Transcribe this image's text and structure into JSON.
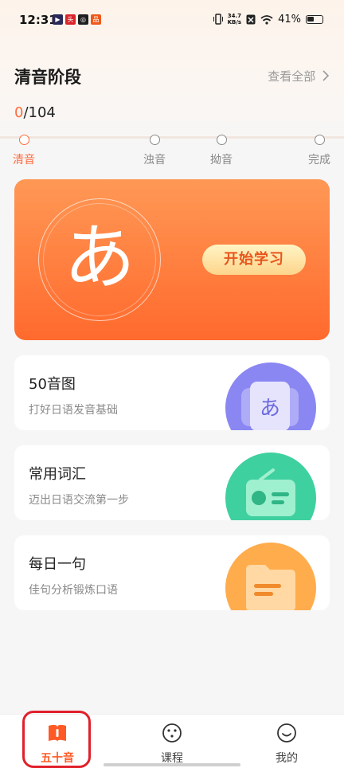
{
  "status_bar": {
    "time": "12:31",
    "net_speed_value": "34.7",
    "net_speed_unit": "KB/s",
    "battery_percent": "41%",
    "app_icons": [
      {
        "name": "video-app-icon",
        "color": "#2a2a5a",
        "glyph": "▶"
      },
      {
        "name": "news-app-icon",
        "color": "#d8262c",
        "glyph": "头"
      },
      {
        "name": "browser-app-icon",
        "color": "#1f1f1f",
        "glyph": "◎"
      },
      {
        "name": "shop-app-icon",
        "color": "#ee5a1b",
        "glyph": "品"
      }
    ]
  },
  "stage": {
    "title": "清音阶段",
    "view_all": "查看全部",
    "progress_current": "0",
    "progress_total": "/104",
    "steps": [
      "清音",
      "浊音",
      "拗音",
      "完成"
    ]
  },
  "hero": {
    "kana": "あ",
    "start_label": "开始学习"
  },
  "cards": [
    {
      "title": "50音图",
      "subtitle": "打好日语发音基础",
      "icon": "kana-chart-icon"
    },
    {
      "title": "常用词汇",
      "subtitle": "迈出日语交流第一步",
      "icon": "radio-card-icon"
    },
    {
      "title": "每日一句",
      "subtitle": "佳句分析锻炼口语",
      "icon": "folder-icon"
    }
  ],
  "nav": {
    "items": [
      "五十音",
      "课程",
      "我的"
    ]
  },
  "colors": {
    "accent": "#ff6b3d",
    "card1_icon": "#8a87f2",
    "card2_icon": "#3fd0a0",
    "card3_icon": "#ffac4d"
  }
}
